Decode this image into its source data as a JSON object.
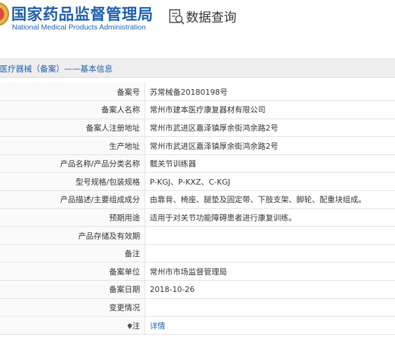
{
  "header": {
    "org_name_cn": "国家药品监督管理局",
    "org_name_en": "National Medical Products Administration",
    "query_title": "数据查询",
    "brand_color": "#1f5fae",
    "icons": [
      "nmpa-logo-icon",
      "data-query-icon"
    ]
  },
  "section": {
    "title": "的医疗器械（备案）——基本信息"
  },
  "rows": [
    {
      "label": "备案号",
      "value": "苏常械备20180198号"
    },
    {
      "label": "备案人名称",
      "value": "常州市建本医疗康复器材有限公司"
    },
    {
      "label": "备案人注册地址",
      "value": "常州市武进区嘉泽镇厚余街鸿余路2号"
    },
    {
      "label": "生产地址",
      "value": "常州市武进区嘉泽镇厚余街鸿余路2号"
    },
    {
      "label": "产品名称/产品分类名称",
      "value": "髋关节训练器"
    },
    {
      "label": "型号规格/包装规格",
      "value": "P-KGJ、P-KXZ、C-KGJ"
    },
    {
      "label": "产品描述/主要组成成分",
      "value": "由靠背、椅座、腿垫及固定带、下肢支架、脚轮、配重块组成。"
    },
    {
      "label": "预期用途",
      "value": "适用于对关节功能障碍患者进行康复训练。"
    },
    {
      "label": "产品存储及有效期",
      "value": ""
    },
    {
      "label": "备注",
      "value": ""
    },
    {
      "label": "备案单位",
      "value": "常州市市场监督管理局"
    },
    {
      "label": "备案日期",
      "value": "2018-10-26"
    },
    {
      "label": "变更情况",
      "value": ""
    },
    {
      "label": "注",
      "value": "详情",
      "icon": "note-marker-icon"
    }
  ]
}
